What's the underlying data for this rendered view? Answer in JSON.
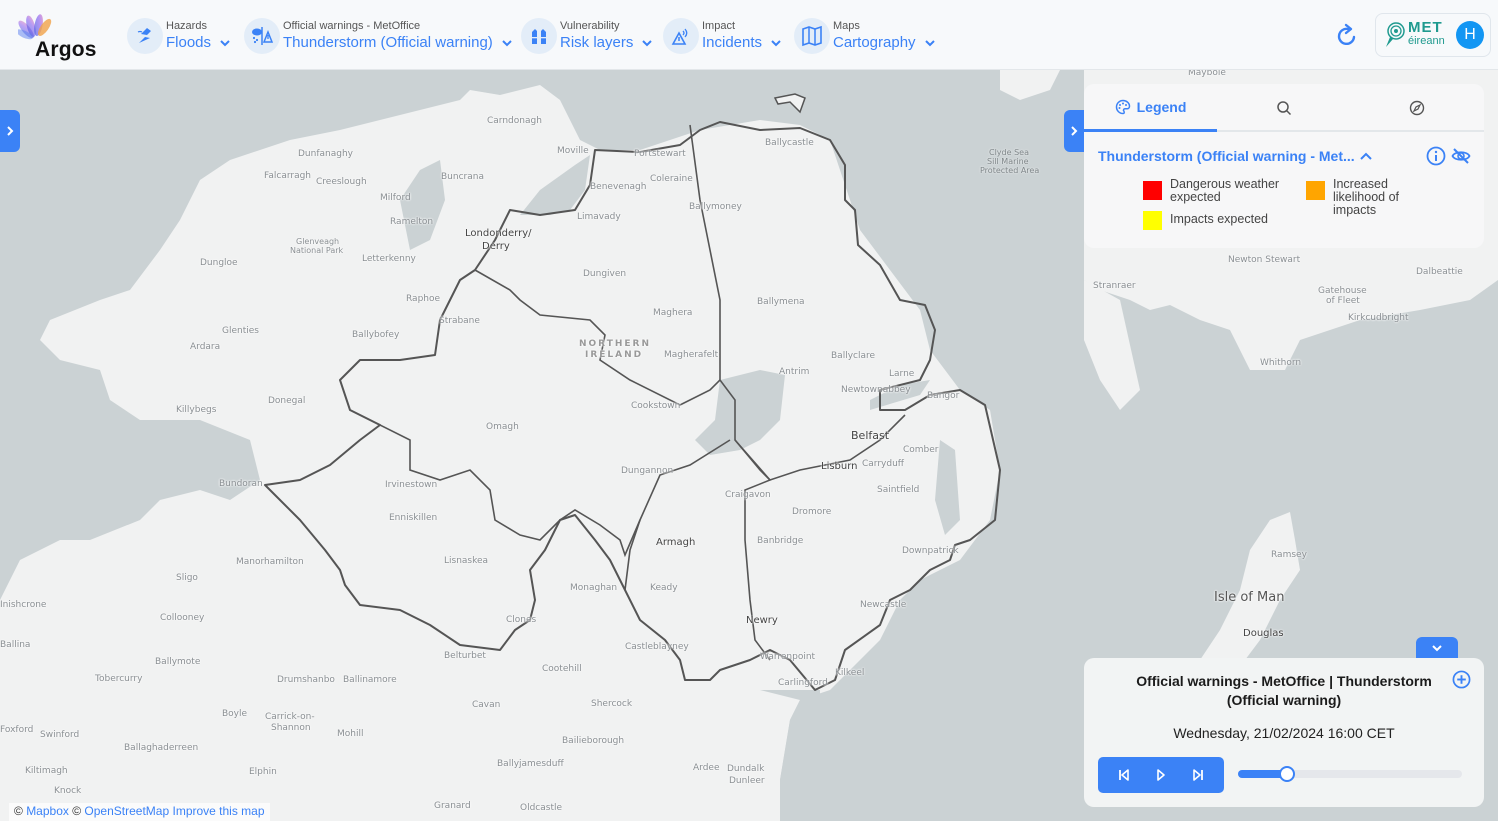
{
  "app": {
    "name": "Argos"
  },
  "nav": [
    {
      "caption": "Hazards",
      "value": "Floods",
      "icon": "flood-icon"
    },
    {
      "caption": "Official warnings - MetOffice",
      "value": "Thunderstorm (Official warning)",
      "icon": "thunderstorm-warning-icon"
    },
    {
      "caption": "Vulnerability",
      "value": "Risk layers",
      "icon": "life-vest-icon"
    },
    {
      "caption": "Impact",
      "value": "Incidents",
      "icon": "incident-alert-icon"
    },
    {
      "caption": "Maps",
      "value": "Cartography",
      "icon": "map-icon"
    }
  ],
  "header_right": {
    "brand_line1": "MET",
    "brand_line2": "éireann",
    "avatar_initial": "H"
  },
  "legend_panel": {
    "tabs": [
      {
        "label": "Legend",
        "icon": "palette-icon",
        "active": true
      },
      {
        "label": "",
        "icon": "search-icon",
        "active": false
      },
      {
        "label": "",
        "icon": "compass-icon",
        "active": false
      }
    ],
    "layer_title": "Thunderstorm (Official warning - Met...",
    "items": [
      {
        "label": "Dangerous weather expected",
        "color": "#ff0000"
      },
      {
        "label": "Increased likelihood of impacts",
        "color": "#ffa500"
      },
      {
        "label": "Impacts expected",
        "color": "#ffff00"
      }
    ]
  },
  "timeline": {
    "title": "Official warnings - MetOffice | Thunderstorm (Official warning)",
    "datetime": "Wednesday, 21/02/2024 16:00 CET",
    "progress": 0.22
  },
  "attribution": {
    "copy1": "©",
    "mapbox": "Mapbox",
    "copy2": "©",
    "osm": "OpenStreetMap",
    "improve": "Improve this map"
  },
  "map_labels": {
    "cities": [
      "Londonderry/",
      "Derry",
      "Belfast",
      "Armagh",
      "Newry",
      "Lisburn",
      "Isle of Man",
      "Douglas"
    ],
    "region": [
      "NORTHERN",
      "IRELAND"
    ],
    "towns": [
      "Carndonagh",
      "Moville",
      "Portstewart",
      "Ballycastle",
      "Dunfanaghy",
      "Falcarragh",
      "Creeslough",
      "Buncrana",
      "Milford",
      "Ramelton",
      "Glenveagh",
      "National Park",
      "Letterkenny",
      "Dungloe",
      "Benevenagh",
      "Coleraine",
      "Limavady",
      "Ballymoney",
      "Dungiven",
      "Raphoe",
      "Strabane",
      "Ballybofey",
      "Glenties",
      "Ardara",
      "Maghera",
      "Magherafelt",
      "Ballymena",
      "Ballyclare",
      "Larne",
      "Antrim",
      "Newtownabbey",
      "Bangor",
      "Cookstown",
      "Omagh",
      "Donegal",
      "Killybegs",
      "Dungannon",
      "Craigavon",
      "Carryduff",
      "Comber",
      "Saintfield",
      "Dromore",
      "Banbridge",
      "Downpatrick",
      "Newcastle",
      "Kilkeel",
      "Carlingford",
      "Warrenpoint",
      "Dundalk",
      "Bundoran",
      "Irvinestown",
      "Enniskillen",
      "Lisnaskea",
      "Manorhamilton",
      "Sligo",
      "Collooney",
      "Inishcrone",
      "Ballina",
      "Ballymote",
      "Tobercurry",
      "Monaghan",
      "Clones",
      "Keady",
      "Castleblayney",
      "Belturbet",
      "Cootehill",
      "Cavan",
      "Shercock",
      "Bailieborough",
      "Drumshanbo",
      "Ballinamore",
      "Carrick-on-",
      "Shannon",
      "Boyle",
      "Foxford",
      "Swinford",
      "Ballaghaderreen",
      "Kiltimagh",
      "Elphin",
      "Mohill",
      "Knock",
      "Ballyjamesduff",
      "Granard",
      "Oldcastle",
      "Ardee",
      "Dunleer",
      "Maybole",
      "Newton Stewart",
      "Dalbeattie",
      "Stranraer",
      "Gatehouse",
      "of Fleet",
      "Kirkcudbright",
      "Whithorn",
      "Ramsey",
      "Clyde Sea",
      "Sill Marine",
      "Protected Area"
    ]
  }
}
